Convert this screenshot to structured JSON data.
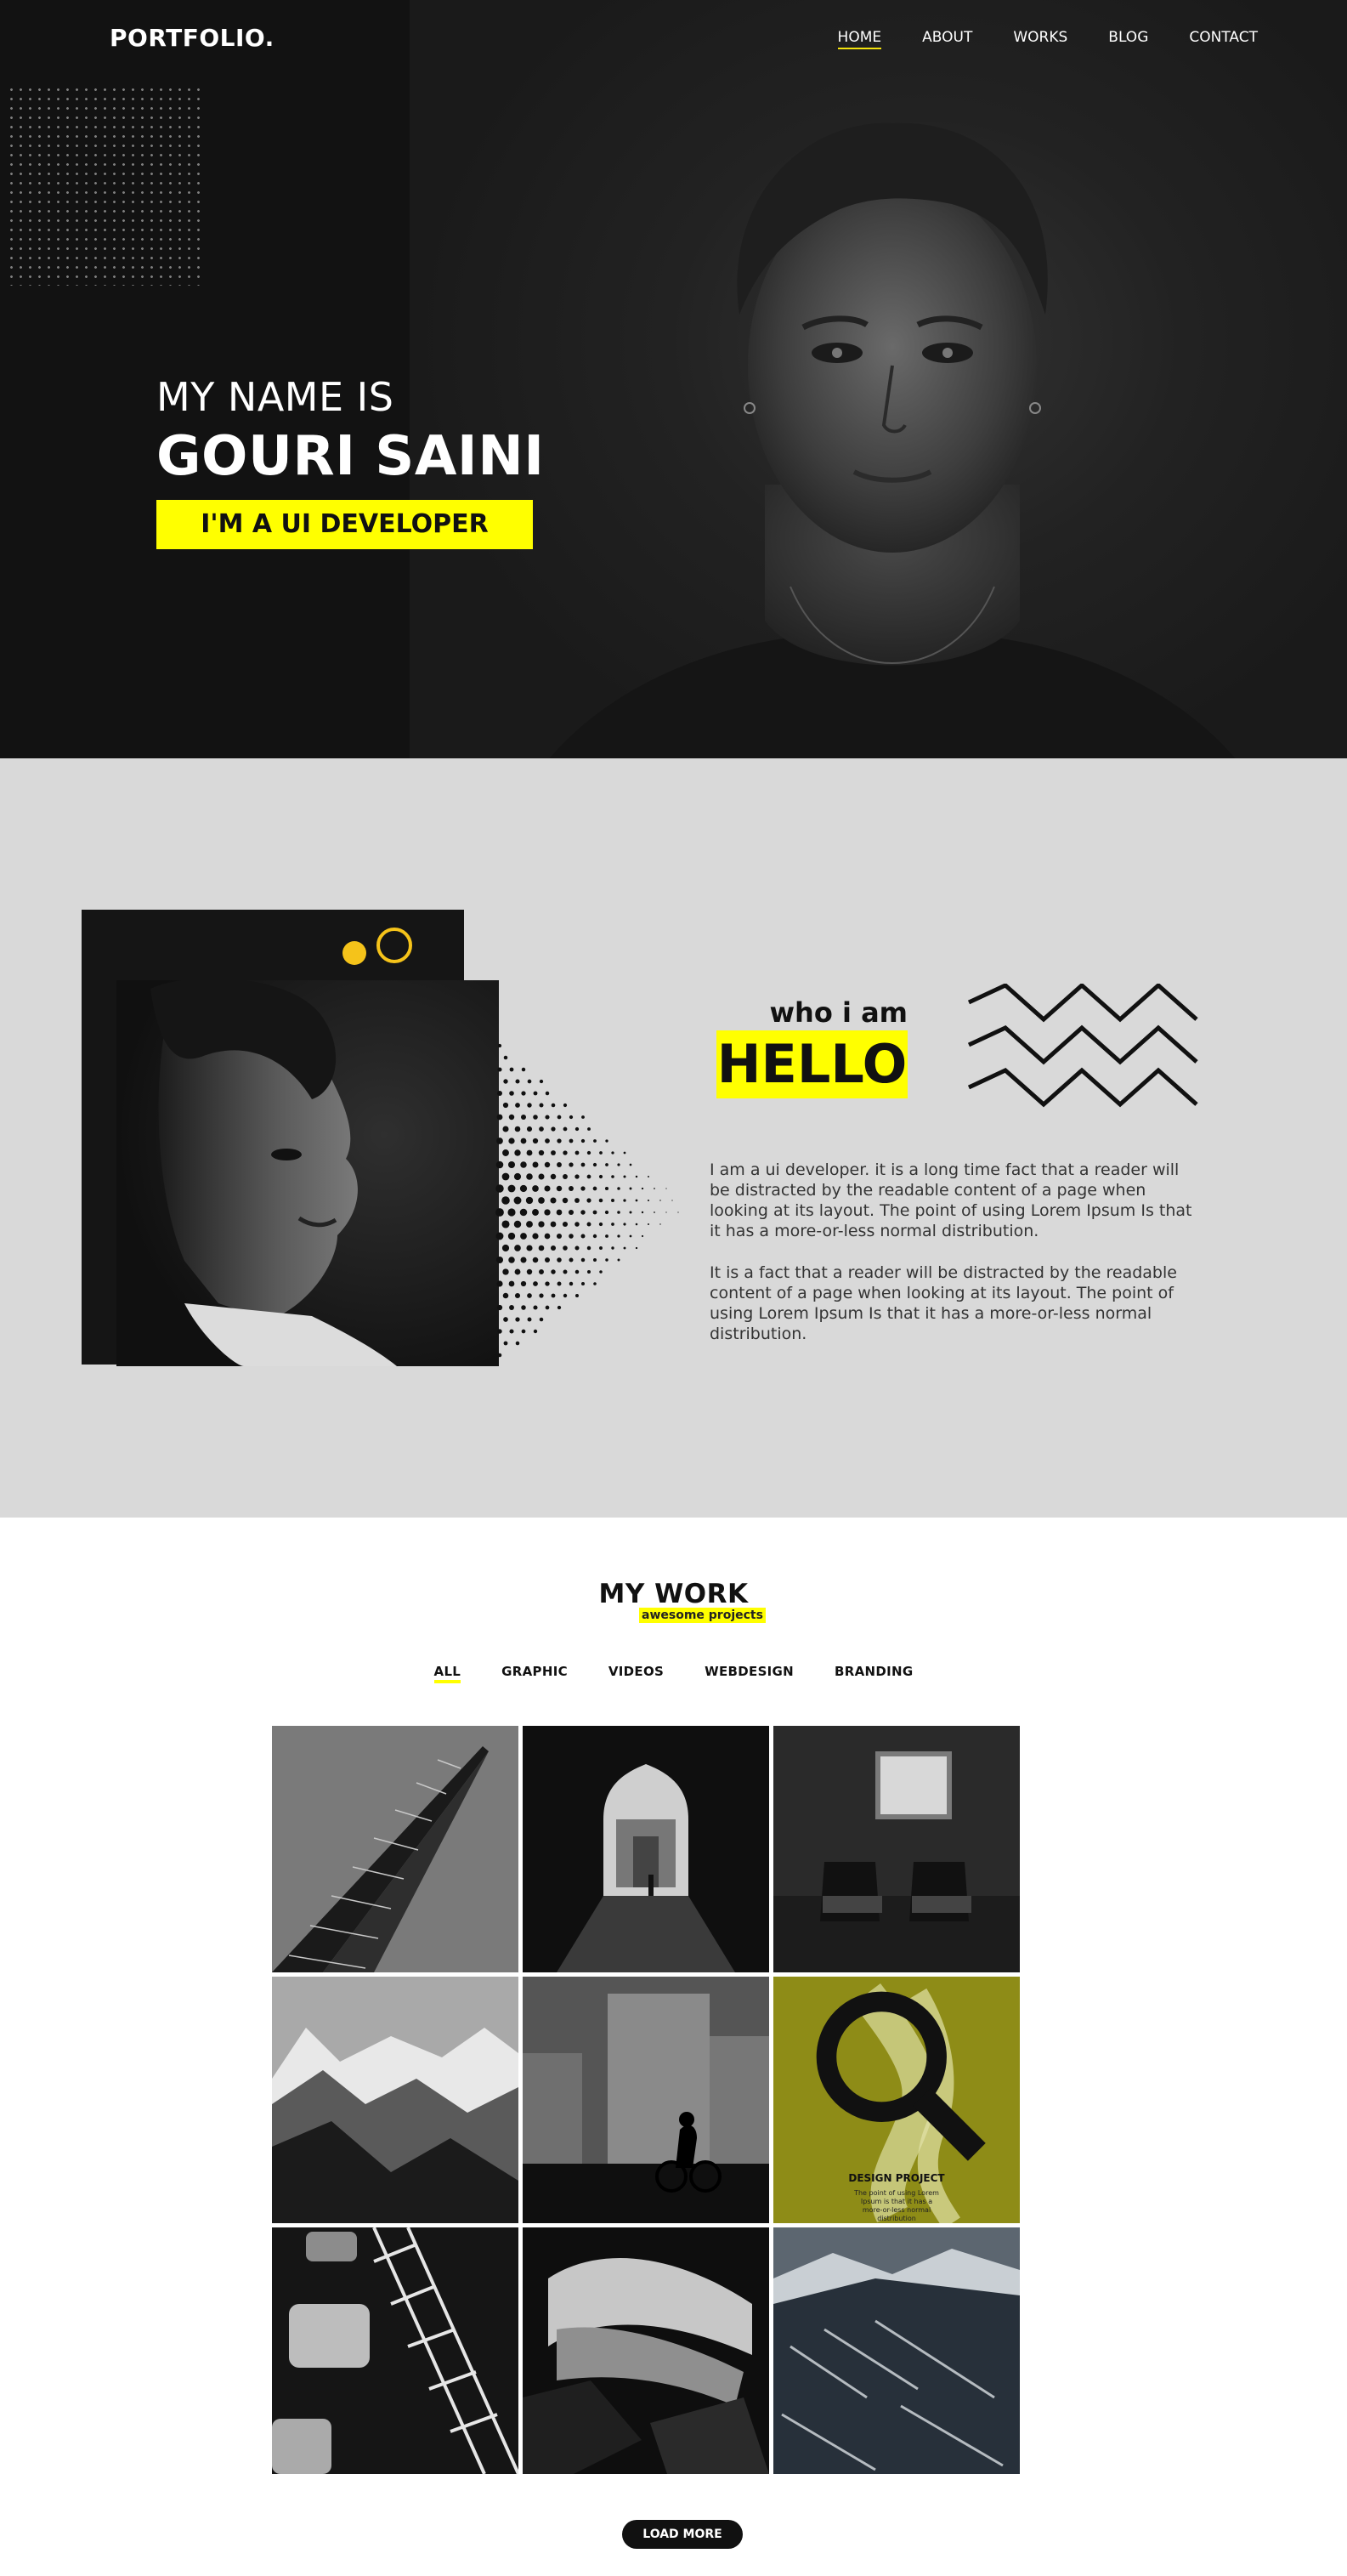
{
  "header": {
    "logo": "PORTFOLIO.",
    "nav": [
      {
        "label": "HOME",
        "active": true
      },
      {
        "label": "ABOUT",
        "active": false
      },
      {
        "label": "WORKS",
        "active": false
      },
      {
        "label": "BLOG",
        "active": false
      },
      {
        "label": "CONTACT",
        "active": false
      }
    ]
  },
  "hero": {
    "subtitle": "MY NAME IS",
    "name": "GOURI SAINI",
    "role": "I'M A UI DEVELOPER"
  },
  "about": {
    "eyebrow": "who i am",
    "heading": "HELLO",
    "paragraph_1": "I am a ui developer. it is a long time fact that a reader will be distracted by the readable content of a page when looking at its layout. The point of using Lorem Ipsum Is that it has a more-or-less normal distribution.",
    "paragraph_2": "It is a fact that a reader will be distracted by the readable content of a page when looking at its layout. The point of using Lorem Ipsum Is that it has a more-or-less normal distribution."
  },
  "work": {
    "title": "MY WORK",
    "subtitle": "awesome projects",
    "filters": [
      {
        "label": "ALL",
        "active": true
      },
      {
        "label": "GRAPHIC",
        "active": false
      },
      {
        "label": "VIDEOS",
        "active": false
      },
      {
        "label": "WEBDESIGN",
        "active": false
      },
      {
        "label": "BRANDING",
        "active": false
      }
    ],
    "hover_tile": {
      "title": "DESIGN PROJECT",
      "text": "The point of using Lorem Ipsum is that it has a more-or-less normal distribution",
      "icon": "search-icon"
    },
    "load_more": "LOAD MORE"
  },
  "colors": {
    "accent": "#ffff00",
    "accent_warm": "#f5c31a",
    "dark": "#121212",
    "section_gray": "#d9d9d9"
  }
}
